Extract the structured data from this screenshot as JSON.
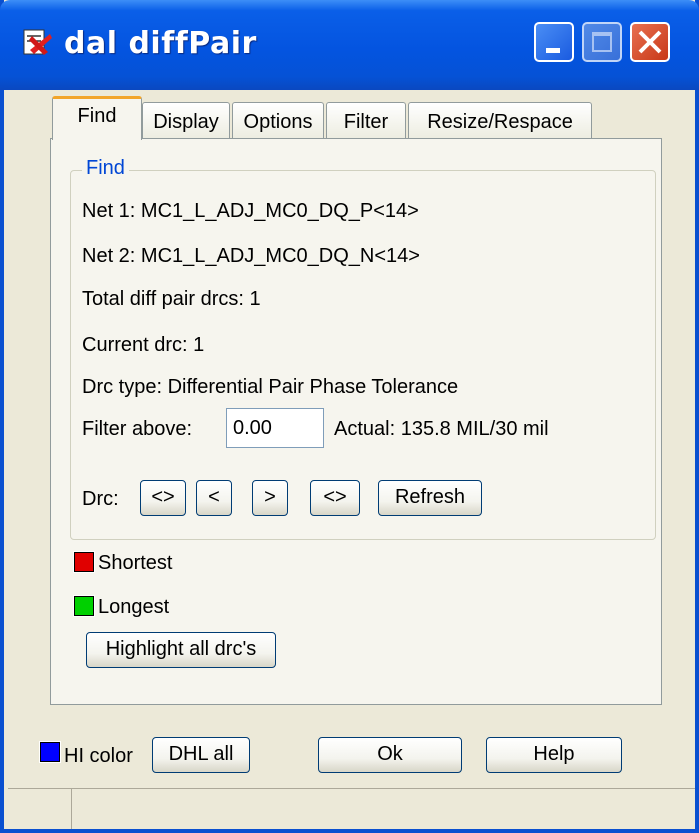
{
  "window": {
    "title": "dal diffPair"
  },
  "tabs": [
    {
      "label": "Find"
    },
    {
      "label": "Display"
    },
    {
      "label": "Options"
    },
    {
      "label": "Filter"
    },
    {
      "label": "Resize/Respace"
    }
  ],
  "find": {
    "group_label": "Find",
    "net1": "Net 1:  MC1_L_ADJ_MC0_DQ_P<14>",
    "net2": "Net 2:  MC1_L_ADJ_MC0_DQ_N<14>",
    "total": "Total diff pair drcs:   1",
    "current": "Current drc:  1",
    "drc_type": "Drc type:  Differential Pair Phase Tolerance",
    "filter_label": "Filter above:",
    "filter_value": "0.00",
    "actual": "Actual: 135.8 MIL/30 mil",
    "drc_label": "Drc:",
    "nav_first": "<>",
    "nav_prev": "<",
    "nav_next": ">",
    "nav_last": "<>",
    "refresh": "Refresh"
  },
  "legend": {
    "shortest": "Shortest",
    "shortest_color": "#e00000",
    "longest": "Longest",
    "longest_color": "#00d000",
    "highlight_all": "Highlight all drc's"
  },
  "footer": {
    "hi_color_label": "HI color",
    "hi_color": "#0000ff",
    "dhl_all": "DHL all",
    "ok": "Ok",
    "help": "Help"
  }
}
